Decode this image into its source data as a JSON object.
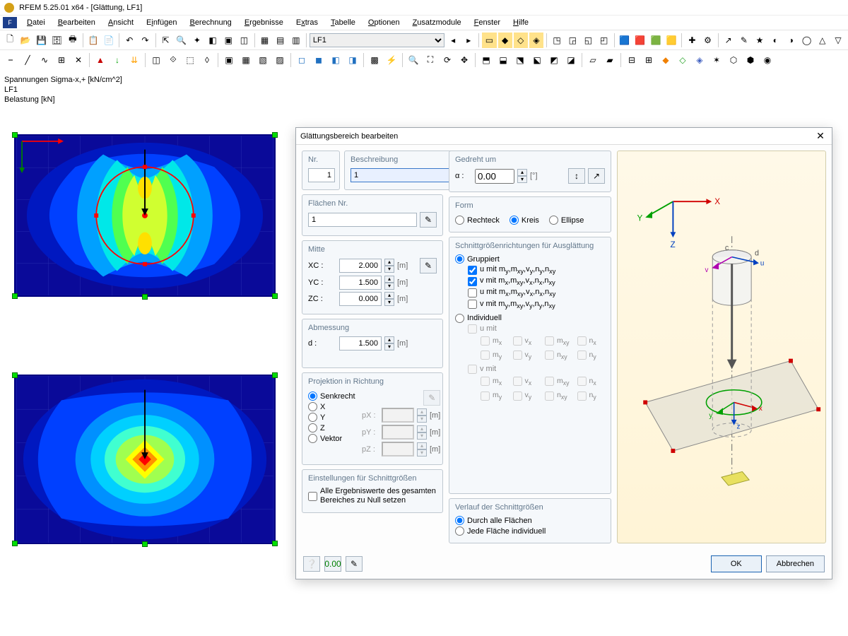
{
  "title": "RFEM 5.25.01 x64 - [Glättung, LF1]",
  "menu": [
    "Datei",
    "Bearbeiten",
    "Ansicht",
    "Einfügen",
    "Berechnung",
    "Ergebnisse",
    "Extras",
    "Tabelle",
    "Optionen",
    "Zusatzmodule",
    "Fenster",
    "Hilfe"
  ],
  "loadcase": "LF1",
  "ws_info": [
    "Spannungen Sigma-x,+ [kN/cm^2]",
    "LF1",
    "Belastung [kN]"
  ],
  "dialog": {
    "title": "Glättungsbereich bearbeiten",
    "nr": {
      "label": "Nr.",
      "value": "1"
    },
    "beschreibung": {
      "label": "Beschreibung",
      "value": "1"
    },
    "flaechen": {
      "label": "Flächen Nr.",
      "value": "1"
    },
    "gedreht": {
      "label": "Gedreht um",
      "sym": "α :",
      "value": "0.00",
      "unit": "[°]"
    },
    "mitte": {
      "label": "Mitte",
      "xc": {
        "label": "XC :",
        "value": "2.000",
        "unit": "[m]"
      },
      "yc": {
        "label": "YC :",
        "value": "1.500",
        "unit": "[m]"
      },
      "zc": {
        "label": "ZC :",
        "value": "0.000",
        "unit": "[m]"
      }
    },
    "form": {
      "label": "Form",
      "options": [
        "Rechteck",
        "Kreis",
        "Ellipse"
      ],
      "selected": "Kreis"
    },
    "abmessung": {
      "label": "Abmessung",
      "d": {
        "label": "d :",
        "value": "1.500",
        "unit": "[m]"
      }
    },
    "schnitt": {
      "label": "Schnittgrößenrichtungen für Ausglättung",
      "gruppiert": "Gruppiert",
      "grp_opts": [
        "u mit my,mxy,vy,ny,nxy",
        "v mit mx,mxy,vx,nx,nxy",
        "u mit mx,mxy,vx,nx,nxy",
        "v mit my,mxy,vy,ny,nxy"
      ],
      "grp_checked": [
        true,
        true,
        false,
        false
      ],
      "individuell": "Individuell",
      "u_mit": "u mit",
      "v_mit": "v mit",
      "cols": [
        "mx",
        "vx",
        "mxy",
        "nx",
        "my",
        "vy",
        "nxy",
        "ny"
      ]
    },
    "projektion": {
      "label": "Projektion in Richtung",
      "opts": [
        "Senkrecht",
        "X",
        "Y",
        "Z",
        "Vektor"
      ],
      "px": "pX :",
      "py": "pY :",
      "pz": "pZ :",
      "unit": "[m]"
    },
    "einst": {
      "label": "Einstellungen für Schnittgrößen",
      "chk": "Alle Ergebniswerte des gesamten Bereiches zu Null setzen"
    },
    "verlauf": {
      "label": "Verlauf der Schnittgrößen",
      "opt1": "Durch alle Flächen",
      "opt2": "Jede Fläche individuell"
    },
    "buttons": {
      "ok": "OK",
      "cancel": "Abbrechen"
    },
    "axes": {
      "x": "X",
      "y": "Y",
      "z": "Z"
    }
  }
}
